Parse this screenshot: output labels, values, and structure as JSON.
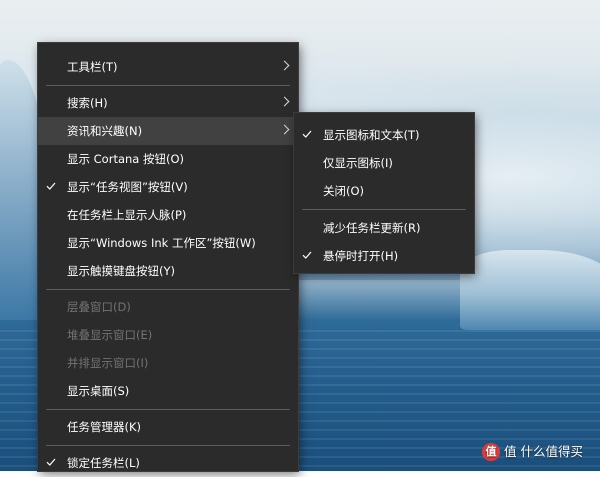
{
  "main_menu": {
    "items": [
      {
        "label": "工具栏(T)",
        "submenu": true
      },
      {
        "label": "搜索(H)",
        "submenu": true
      },
      {
        "label": "资讯和兴趣(N)",
        "submenu": true,
        "highlighted": true
      },
      {
        "label": "显示 Cortana 按钮(O)"
      },
      {
        "label": "显示“任务视图”按钮(V)",
        "checked": true
      },
      {
        "label": "在任务栏上显示人脉(P)"
      },
      {
        "label": "显示“Windows Ink 工作区”按钮(W)"
      },
      {
        "label": "显示触摸键盘按钮(Y)"
      },
      {
        "label": "层叠窗口(D)",
        "disabled": true
      },
      {
        "label": "堆叠显示窗口(E)",
        "disabled": true
      },
      {
        "label": "并排显示窗口(I)",
        "disabled": true
      },
      {
        "label": "显示桌面(S)"
      },
      {
        "label": "任务管理器(K)"
      },
      {
        "label": "锁定任务栏(L)",
        "checked": true
      }
    ]
  },
  "sub_menu": {
    "items": [
      {
        "label": "显示图标和文本(T)",
        "checked": true
      },
      {
        "label": "仅显示图标(I)"
      },
      {
        "label": "关闭(O)"
      },
      {
        "label": "减少任务栏更新(R)"
      },
      {
        "label": "悬停时打开(H)",
        "checked": true
      }
    ]
  },
  "watermark": {
    "text": "值 什么值得买",
    "logo_glyph": "值"
  },
  "icons": {
    "check": "checkmark-icon",
    "arrow": "chevron-right-icon"
  }
}
